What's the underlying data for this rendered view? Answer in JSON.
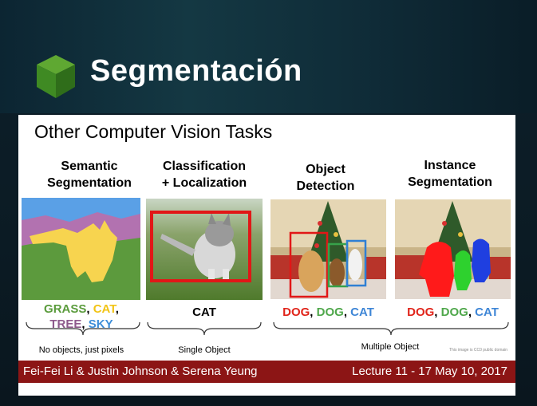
{
  "header": {
    "title": "Segmentación"
  },
  "slide": {
    "heading": "Other Computer Vision Tasks",
    "tasks": [
      {
        "label": "Semantic\nSegmentation"
      },
      {
        "label": "Classification\n+ Localization"
      },
      {
        "label": "Object\nDetection"
      },
      {
        "label": "Instance\nSegmentation"
      }
    ],
    "semantic_caption": {
      "grass": "GRASS",
      "comma1": ", ",
      "cat": "CAT",
      "comma2": ",",
      "tree": "TREE",
      "comma3": ", ",
      "sky": "SKY"
    },
    "classification_caption": "CAT",
    "detection_caption": {
      "dog1": "DOG",
      "sep1": ", ",
      "dog2": "DOG",
      "sep2": ", ",
      "cat": "CAT"
    },
    "instance_caption": {
      "dog1": "DOG",
      "sep1": ", ",
      "dog2": "DOG",
      "sep2": ", ",
      "cat": "CAT"
    },
    "notes": {
      "semantic": "No objects, just pixels",
      "classification": "Single Object",
      "multiple": "Multiple Object"
    },
    "credit": "This image is CC0 public domain",
    "footer": {
      "authors": "Fei-Fei Li & Justin Johnson & Serena Yeung",
      "lecture": "Lecture 11 -   17  May 10, 2017"
    }
  },
  "colors": {
    "grass": "#5a9b3c",
    "cat": "#f2c416",
    "tree": "#8e5a8c",
    "sky": "#3e8ed9",
    "footer": "#8c1515"
  }
}
